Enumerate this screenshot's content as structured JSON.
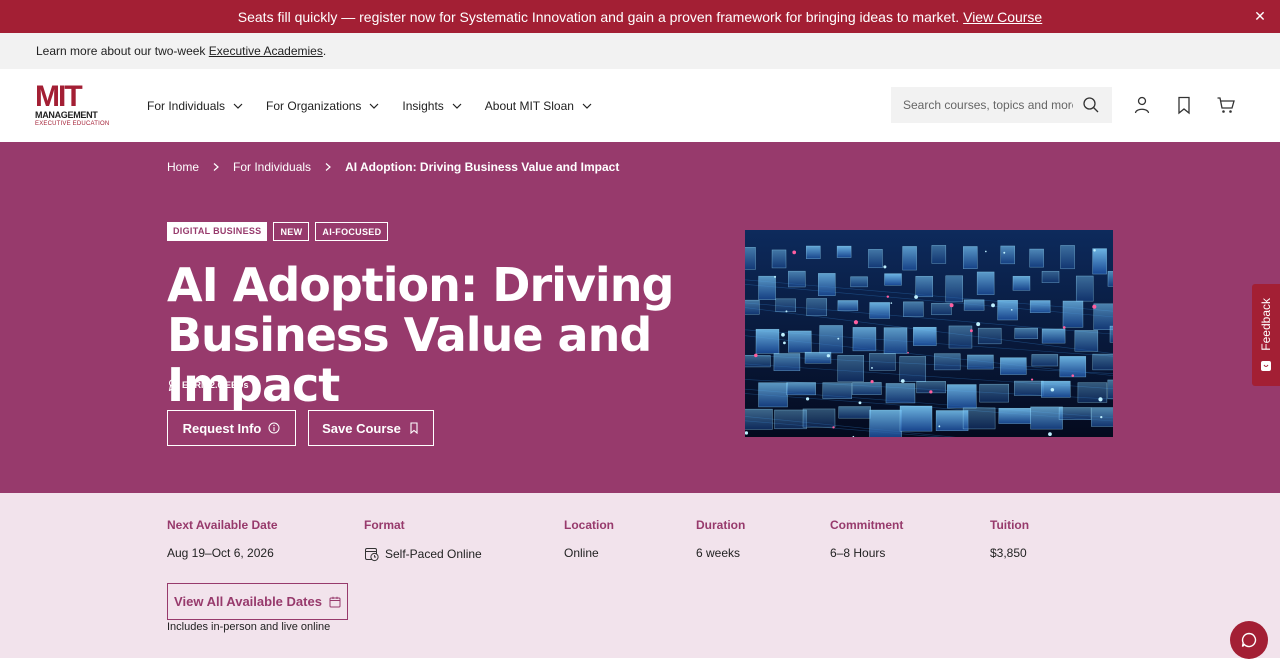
{
  "colors": {
    "brand_red": "#a31f34",
    "hero_plum": "#973a6c",
    "details_bg": "#f2e3ec"
  },
  "alert": {
    "text": "Seats fill quickly — register now for Systematic Innovation and gain a proven framework for bringing ideas to market.",
    "link": "View Course",
    "close_icon": "close-icon"
  },
  "info_strip": {
    "text": "Learn more about our two-week",
    "link": "Executive Academies",
    "suffix": "."
  },
  "header": {
    "logo": {
      "mark": "MIT",
      "line1": "MANAGEMENT",
      "line2": "EXECUTIVE EDUCATION"
    },
    "nav": [
      "For Individuals",
      "For Organizations",
      "Insights",
      "About MIT Sloan"
    ],
    "search": {
      "placeholder": "Search courses, topics and more",
      "value": ""
    },
    "icons": [
      "user-icon",
      "bookmark-icon",
      "cart-icon"
    ]
  },
  "hero": {
    "breadcrumb": [
      "Home",
      "For Individuals",
      "AI Adoption: Driving Business Value and Impact"
    ],
    "tags": [
      "DIGITAL BUSINESS",
      "NEW",
      "AI-FOCUSED"
    ],
    "title": "AI Adoption: Driving Business Value and Impact",
    "eeu": "EARN 2.0 EEUs",
    "request_info": "Request Info",
    "save_course": "Save Course"
  },
  "feedback": {
    "label": "Feedback"
  },
  "details": {
    "columns": [
      {
        "head": "Next Available Date",
        "value": "Aug 19–Oct 6, 2026"
      },
      {
        "head": "Format",
        "value": "Self-Paced Online"
      },
      {
        "head": "Location",
        "value": "Online"
      },
      {
        "head": "Duration",
        "value": "6 weeks"
      },
      {
        "head": "Commitment",
        "value": "6–8 Hours"
      },
      {
        "head": "Tuition",
        "value": "$3,850"
      }
    ],
    "dates_button": "View All Available Dates",
    "dates_note": "Includes in-person and live online"
  }
}
